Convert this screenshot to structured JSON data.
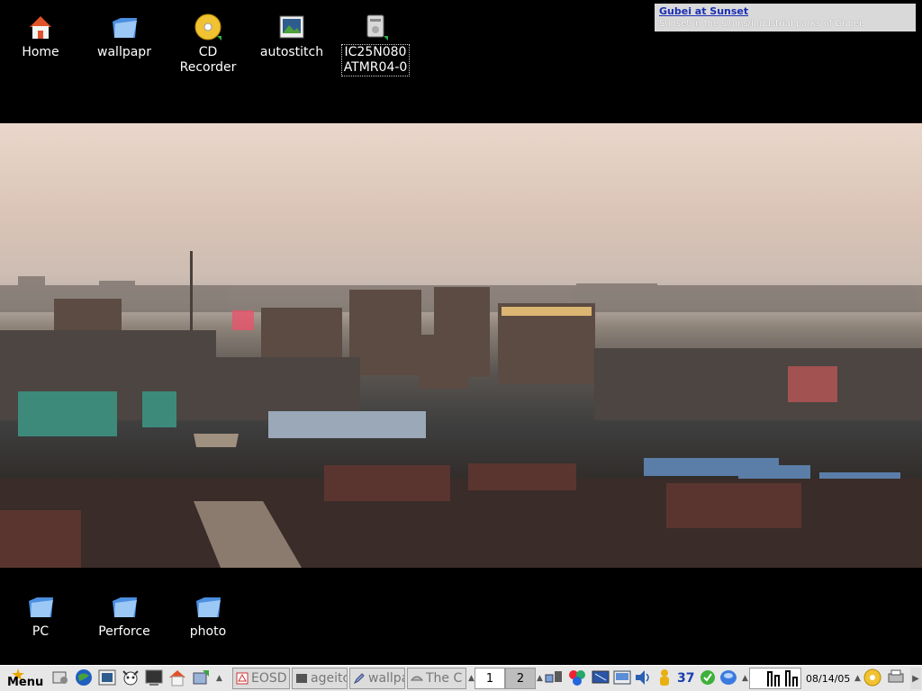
{
  "desktop": {
    "top_icons": [
      {
        "label": "Home",
        "icon": "home-icon"
      },
      {
        "label": "wallpapr",
        "icon": "folder-icon"
      },
      {
        "label": "CD\nRecorder",
        "icon": "cd-recorder-icon"
      },
      {
        "label": "autostitch",
        "icon": "image-app-icon"
      },
      {
        "label": "IC25N080\nATMR04-0",
        "icon": "hard-drive-icon"
      }
    ],
    "bottom_icons": [
      {
        "label": "PC",
        "icon": "folder-icon"
      },
      {
        "label": "Perforce",
        "icon": "folder-icon"
      },
      {
        "label": "photo",
        "icon": "folder-icon"
      }
    ]
  },
  "infobox": {
    "title": "Gubei at Sunset",
    "description": "Sunset in the slums/industrial parks of Gubei."
  },
  "taskbar": {
    "menu_label": "Menu",
    "tasks": [
      {
        "label": "EOSD",
        "icon": "pdf-icon"
      },
      {
        "label": "ageitc",
        "icon": "terminal-icon"
      },
      {
        "label": "wallpa",
        "icon": "editor-icon"
      },
      {
        "label": "The C",
        "icon": "browser-icon"
      }
    ],
    "pager": [
      "1",
      "2"
    ],
    "tray_number": "37",
    "date": "08/14/05"
  },
  "colors": {
    "desktop_bg": "#000000",
    "taskbar_bg": "#e7e7e7",
    "infobox_bg": "#d9d9d9",
    "infobox_title": "#1a2fb5"
  }
}
